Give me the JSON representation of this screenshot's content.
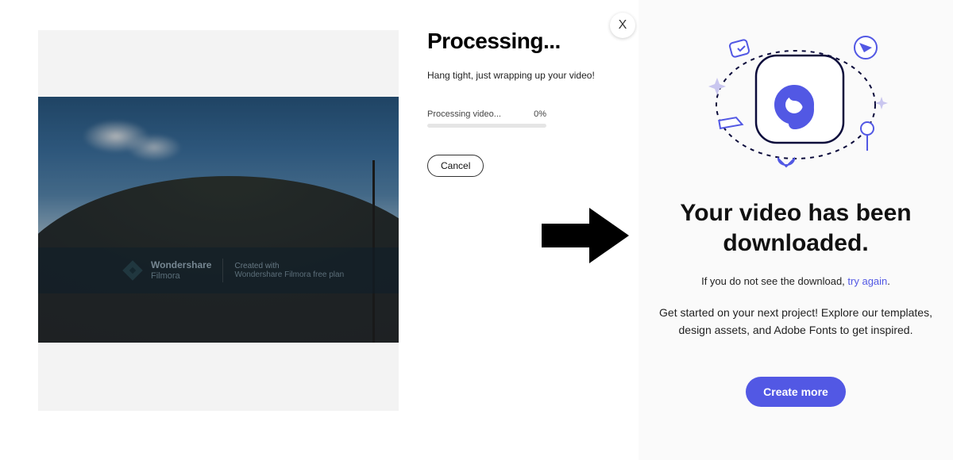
{
  "processing": {
    "title": "Processing...",
    "subtitle": "Hang tight, just wrapping up your video!",
    "status_label": "Processing video...",
    "percent": "0%",
    "cancel_label": "Cancel"
  },
  "watermark": {
    "brand": "Wondershare",
    "product": "Filmora",
    "created_with": "Created with",
    "plan": "Wondershare Filmora free plan"
  },
  "close_label": "X",
  "downloaded": {
    "headline": "Your video has been downloaded.",
    "hint_prefix": "If you do not see the download, ",
    "hint_link": "try again",
    "hint_suffix": ".",
    "body": "Get started on your next project! Explore our templates, design assets, and Adobe Fonts to get inspired.",
    "cta": "Create more"
  },
  "colors": {
    "accent": "#5258e4"
  }
}
